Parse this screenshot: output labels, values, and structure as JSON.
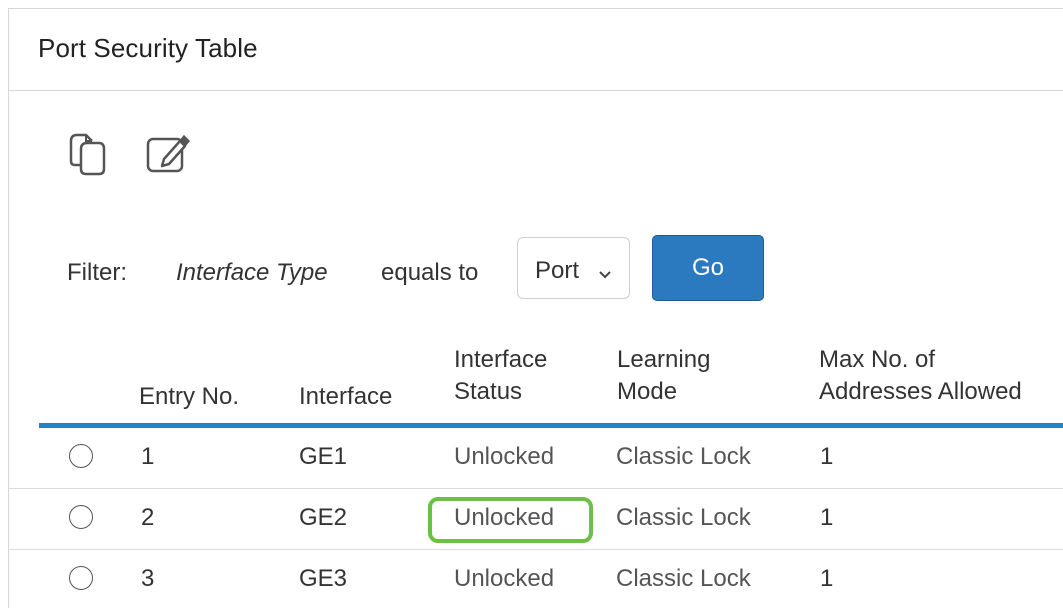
{
  "panel": {
    "title": "Port Security Table"
  },
  "toolbar": {
    "copy_icon": "copy-icon",
    "edit_icon": "edit-icon"
  },
  "filter": {
    "label": "Filter:",
    "field": "Interface Type",
    "operator": "equals to",
    "selected": "Port",
    "go_label": "Go"
  },
  "table": {
    "columns": {
      "entry_no": "Entry No.",
      "interface": "Interface",
      "status_line1": "Interface",
      "status_line2": "Status",
      "learning_line1": "Learning",
      "learning_line2": "Mode",
      "max_line1": "Max No. of",
      "max_line2": "Addresses Allowed"
    },
    "rows": [
      {
        "entry": "1",
        "interface": "GE1",
        "status": "Unlocked",
        "mode": "Classic Lock",
        "max": "1"
      },
      {
        "entry": "2",
        "interface": "GE2",
        "status": "Unlocked",
        "mode": "Classic Lock",
        "max": "1",
        "highlighted": true
      },
      {
        "entry": "3",
        "interface": "GE3",
        "status": "Unlocked",
        "mode": "Classic Lock",
        "max": "1"
      }
    ]
  },
  "colors": {
    "accent": "#1f84c8",
    "button": "#2b79bf",
    "highlight": "#6bc045"
  }
}
